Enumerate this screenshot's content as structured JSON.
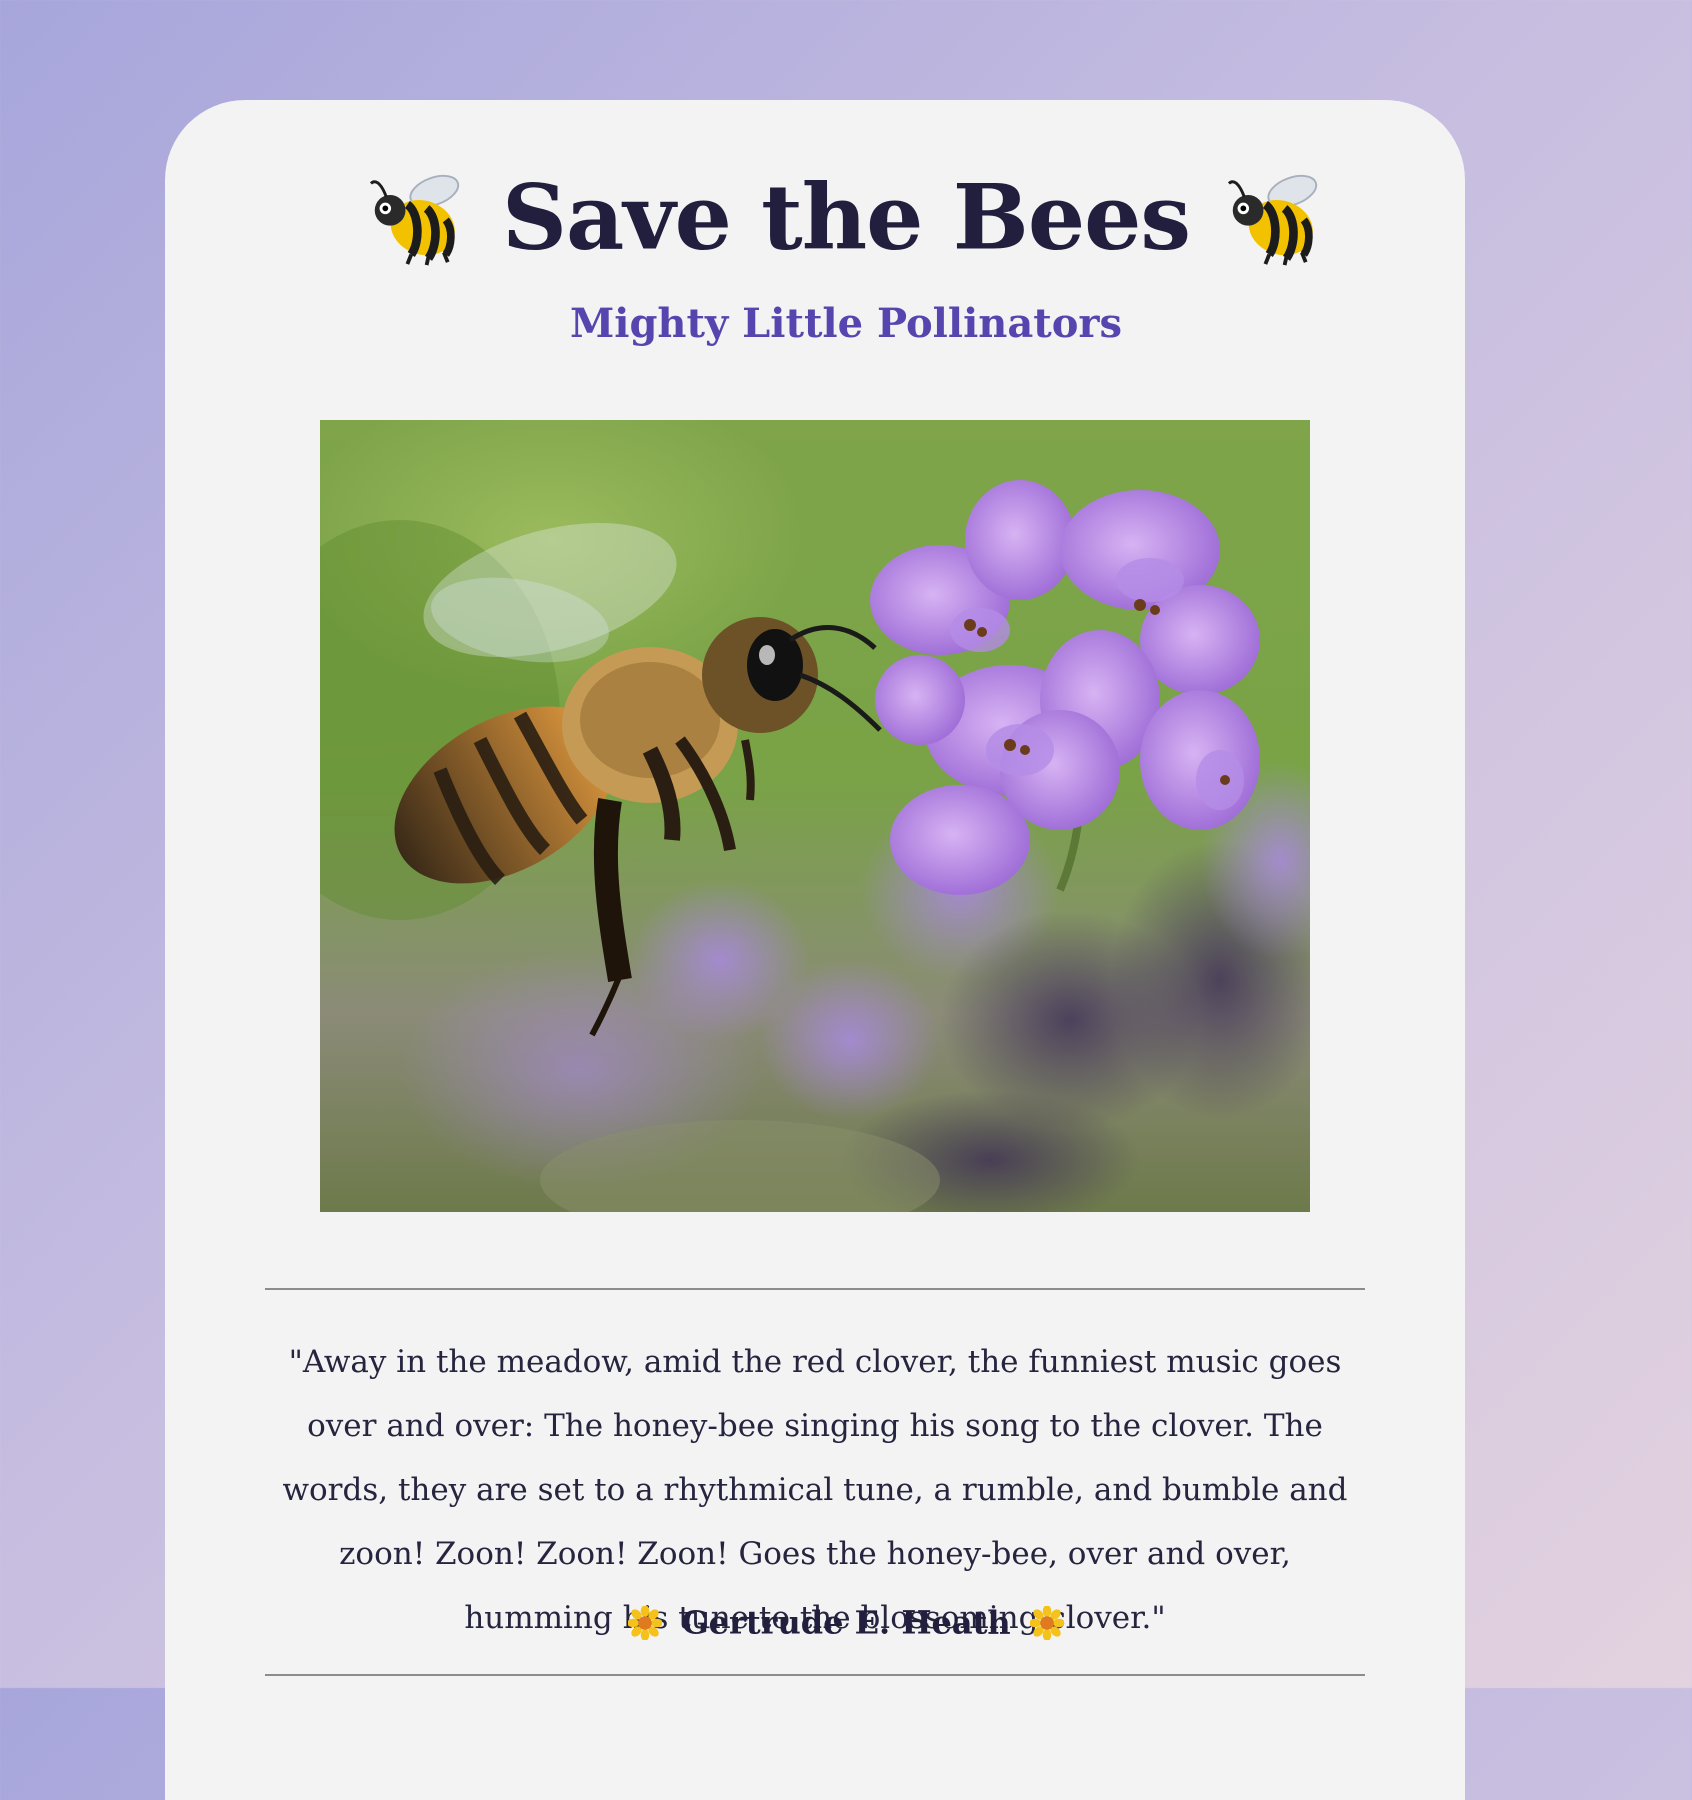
{
  "header": {
    "title": "Save the Bees",
    "subtitle": "Mighty Little Pollinators",
    "title_icon": "honeybee-icon"
  },
  "hero_image": {
    "subject": "honeybee-on-lavender-photo"
  },
  "quote": {
    "text": "\"Away in the meadow, amid the red clover, the funniest music goes over and over: The honey-bee singing his song to the clover. The words, they are set to a rhythmical tune, a rumble, and bumble and zoon! Zoon! Zoon! Zoon! Goes the honey-bee, over and over, humming his tune to the blossoming clover.\"",
    "author": "Gertrude E. Heath",
    "author_icon": "sunflower-icon"
  },
  "colors": {
    "title": "#211f3d",
    "subtitle": "#5645ae",
    "card": "#f3f3f3",
    "divider": "#8c8c8c"
  }
}
